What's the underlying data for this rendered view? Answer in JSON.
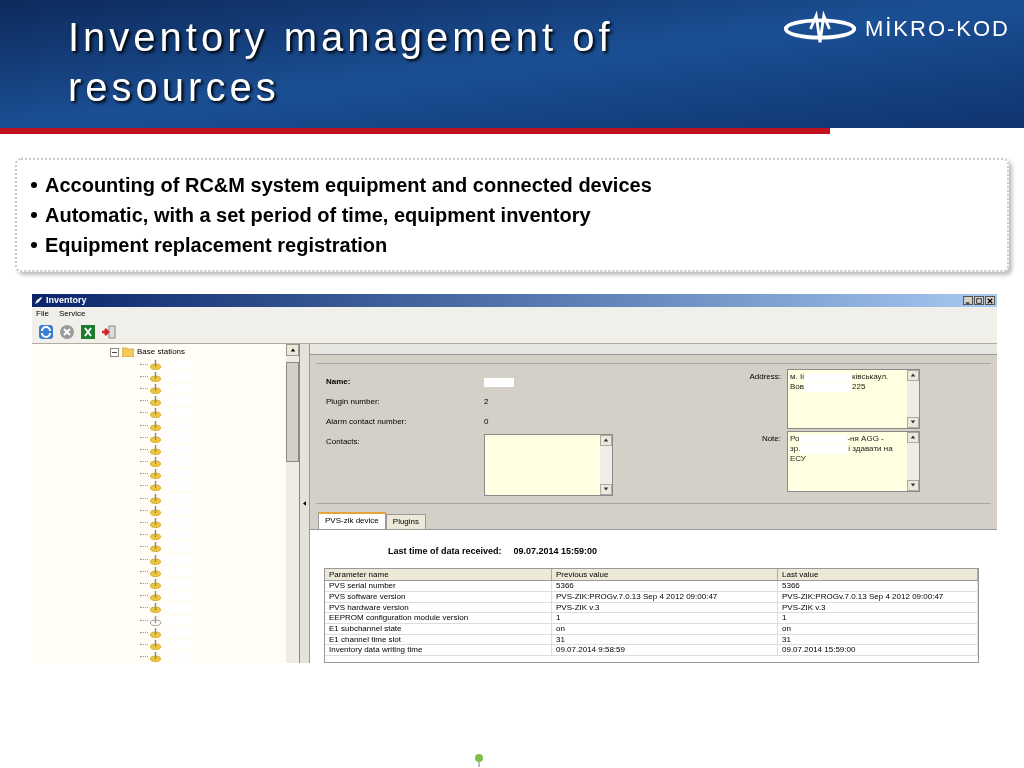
{
  "slide": {
    "title": "Inventory management of resources",
    "logo_text": "MİKRO-KOD"
  },
  "bullets": [
    "Accounting of RC&M system equipment and connected devices",
    "Automatic, with a set period of time, equipment inventory",
    "Equipment replacement registration"
  ],
  "window": {
    "title": "Inventory"
  },
  "menu": [
    "File",
    "Service"
  ],
  "tree": {
    "label": "Base stations",
    "expanded": true,
    "children": [
      {
        "kind": "station"
      },
      {
        "kind": "station"
      },
      {
        "kind": "station"
      },
      {
        "kind": "station"
      },
      {
        "kind": "station"
      },
      {
        "kind": "station"
      },
      {
        "kind": "station"
      },
      {
        "kind": "station"
      },
      {
        "kind": "station"
      },
      {
        "kind": "station"
      },
      {
        "kind": "station"
      },
      {
        "kind": "station"
      },
      {
        "kind": "station"
      },
      {
        "kind": "station"
      },
      {
        "kind": "station"
      },
      {
        "kind": "station"
      },
      {
        "kind": "station"
      },
      {
        "kind": "station"
      },
      {
        "kind": "station"
      },
      {
        "kind": "station"
      },
      {
        "kind": "station"
      },
      {
        "kind": "station-off"
      },
      {
        "kind": "station"
      },
      {
        "kind": "station"
      },
      {
        "kind": "station"
      }
    ]
  },
  "details": {
    "name_label": "Name:",
    "fields": [
      {
        "label": "Plugin number:",
        "value": "2"
      },
      {
        "label": "Alarm contact number:",
        "value": "0"
      }
    ],
    "contacts_label": "Contacts:",
    "address_label": "Address:",
    "address_lines": [
      [
        "м. Іі",
        "ківськаул."
      ],
      [
        "Вов",
        "225"
      ]
    ],
    "note_label": "Note:",
    "note_lines": [
      [
        "Ро",
        "-ня AGG -"
      ],
      [
        "зр.",
        "і здавати на"
      ],
      [
        "ЕСУ"
      ]
    ]
  },
  "tabs": [
    {
      "label": "PVS-zik device",
      "selected": true
    },
    {
      "label": "Plugins",
      "selected": false
    }
  ],
  "last_received": {
    "label": "Last time of data received:",
    "value": "09.07.2014 15:59:00"
  },
  "table": {
    "columns": [
      "Parameter name",
      "Previous value",
      "Last value"
    ],
    "rows": [
      [
        "PVS serial number",
        "5366",
        "5366"
      ],
      [
        "PVS software version",
        "PVS-ZIK:PROGv.7.0.13 Sep  4 2012 09:00:47",
        "PVS-ZIK:PROGv.7.0.13 Sep  4 2012 09:00:47"
      ],
      [
        "PVS hardware version",
        "PVS-ZIK v.3",
        "PVS-ZIK v.3"
      ],
      [
        "EEPROM configuration module version",
        "1",
        "1"
      ],
      [
        "E1 subchannel state",
        "on",
        "on"
      ],
      [
        "E1 channel time slot",
        "31",
        "31"
      ],
      [
        "Inventory data writing time",
        "09.07.2014 9:58:59",
        "09.07.2014 15:59:00"
      ]
    ]
  }
}
